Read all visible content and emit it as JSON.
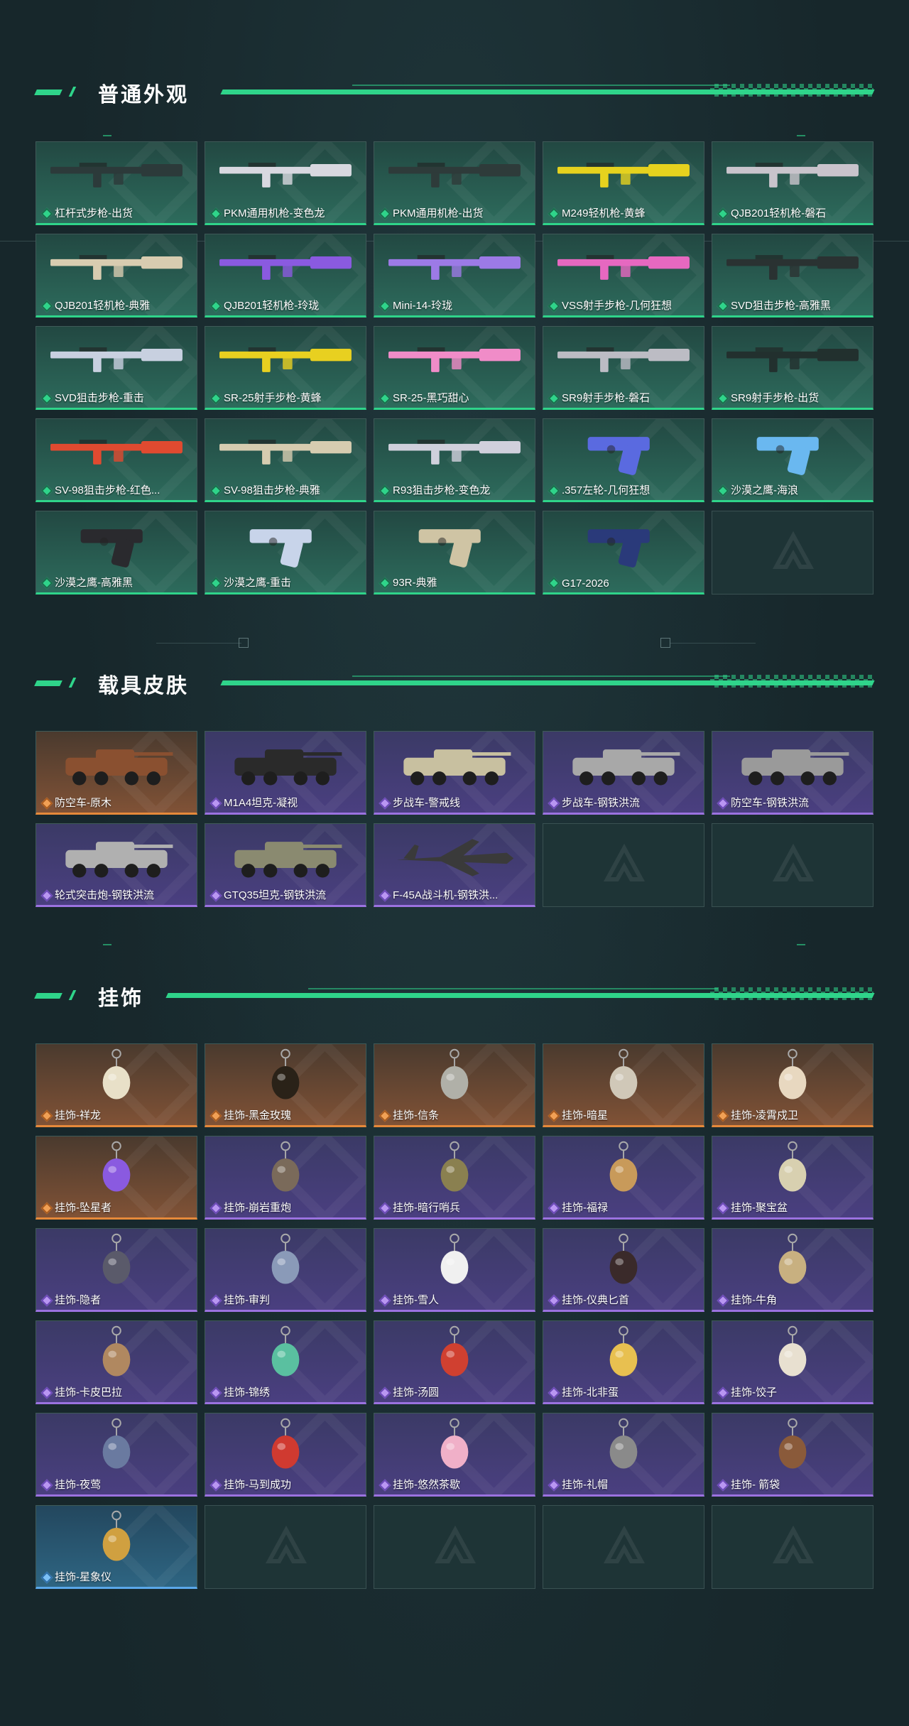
{
  "sections": {
    "weapons": {
      "title": "普通外观",
      "items": [
        {
          "label": "杠杆式步枪-出货",
          "rarity": "green",
          "icon": "rifle-icon",
          "color": "#2c3a3a"
        },
        {
          "label": "PKM通用机枪-变色龙",
          "rarity": "green",
          "icon": "machine-gun-icon",
          "color": "#d8d8e0"
        },
        {
          "label": "PKM通用机枪-出货",
          "rarity": "green",
          "icon": "machine-gun-icon",
          "color": "#2e3b3a"
        },
        {
          "label": "M249轻机枪-黄蜂",
          "rarity": "green",
          "icon": "machine-gun-icon",
          "color": "#e6d21e"
        },
        {
          "label": "QJB201轻机枪-磐石",
          "rarity": "green",
          "icon": "machine-gun-icon",
          "color": "#c9c4cc"
        },
        {
          "label": "QJB201轻机枪-典雅",
          "rarity": "green",
          "icon": "machine-gun-icon",
          "color": "#d8ccb0"
        },
        {
          "label": "QJB201轻机枪-玲珑",
          "rarity": "green",
          "icon": "machine-gun-icon",
          "color": "#8a5ae0"
        },
        {
          "label": "Mini-14-玲珑",
          "rarity": "green",
          "icon": "rifle-icon",
          "color": "#9c7ae6"
        },
        {
          "label": "VSS射手步枪-几何狂想",
          "rarity": "green",
          "icon": "rifle-icon",
          "color": "#e668c0"
        },
        {
          "label": "SVD狙击步枪-高雅黑",
          "rarity": "green",
          "icon": "sniper-rifle-icon",
          "color": "#2a3232"
        },
        {
          "label": "SVD狙击步枪-重击",
          "rarity": "green",
          "icon": "sniper-rifle-icon",
          "color": "#c8d0e0"
        },
        {
          "label": "SR-25射手步枪-黄蜂",
          "rarity": "green",
          "icon": "rifle-icon",
          "color": "#e8d020"
        },
        {
          "label": "SR-25-黑巧甜心",
          "rarity": "green",
          "icon": "rifle-icon",
          "color": "#f08cc8"
        },
        {
          "label": "SR9射手步枪-磐石",
          "rarity": "green",
          "icon": "rifle-icon",
          "color": "#bcbcc4"
        },
        {
          "label": "SR9射手步枪-出货",
          "rarity": "green",
          "icon": "rifle-icon",
          "color": "#22302e"
        },
        {
          "label": "SV-98狙击步枪-红色...",
          "rarity": "green",
          "icon": "sniper-rifle-icon",
          "color": "#e04a30"
        },
        {
          "label": "SV-98狙击步枪-典雅",
          "rarity": "green",
          "icon": "sniper-rifle-icon",
          "color": "#d6ccb0"
        },
        {
          "label": "R93狙击步枪-变色龙",
          "rarity": "green",
          "icon": "sniper-rifle-icon",
          "color": "#d0d0dc"
        },
        {
          "label": ".357左轮-几何狂想",
          "rarity": "green",
          "icon": "revolver-icon",
          "color": "#5a6ae0"
        },
        {
          "label": "沙漠之鹰-海浪",
          "rarity": "green",
          "icon": "pistol-icon",
          "color": "#6ab8f0"
        },
        {
          "label": "沙漠之鹰-高雅黑",
          "rarity": "green",
          "icon": "pistol-icon",
          "color": "#2a2a2e"
        },
        {
          "label": "沙漠之鹰-重击",
          "rarity": "green",
          "icon": "pistol-icon",
          "color": "#c8d4ea"
        },
        {
          "label": "93R-典雅",
          "rarity": "green",
          "icon": "pistol-icon",
          "color": "#cfc4a4"
        },
        {
          "label": "G17-2026",
          "rarity": "green",
          "icon": "pistol-icon",
          "color": "#2a3a7a"
        },
        {
          "label": "",
          "rarity": "empty",
          "icon": "empty-slot-icon",
          "color": ""
        }
      ]
    },
    "vehicles": {
      "title": "载具皮肤",
      "items": [
        {
          "label": "防空车-原木",
          "rarity": "orange",
          "icon": "armored-vehicle-icon",
          "color": "#8a5030"
        },
        {
          "label": "M1A4坦克-凝视",
          "rarity": "purple",
          "icon": "tank-icon",
          "color": "#2a2a2a"
        },
        {
          "label": "步战车-警戒线",
          "rarity": "purple",
          "icon": "armored-vehicle-icon",
          "color": "#c8c0a0"
        },
        {
          "label": "步战车-钢铁洪流",
          "rarity": "purple",
          "icon": "armored-vehicle-icon",
          "color": "#a8a8a8"
        },
        {
          "label": "防空车-钢铁洪流",
          "rarity": "purple",
          "icon": "armored-vehicle-icon",
          "color": "#9a9a9a"
        },
        {
          "label": "轮式突击炮-钢铁洪流",
          "rarity": "purple",
          "icon": "assault-gun-icon",
          "color": "#b0b0b0"
        },
        {
          "label": "GTQ35坦克-钢铁洪流",
          "rarity": "purple",
          "icon": "tank-icon",
          "color": "#8a8a70"
        },
        {
          "label": "F-45A战斗机-钢铁洪...",
          "rarity": "purple",
          "icon": "fighter-jet-icon",
          "color": "#3a3a3a"
        },
        {
          "label": "",
          "rarity": "empty",
          "icon": "empty-slot-icon",
          "color": ""
        },
        {
          "label": "",
          "rarity": "empty",
          "icon": "empty-slot-icon",
          "color": ""
        }
      ]
    },
    "charms": {
      "title": "挂饰",
      "items": [
        {
          "label": "挂饰-祥龙",
          "rarity": "orange",
          "icon": "dragon-charm-icon",
          "color": "#e8e0c8"
        },
        {
          "label": "挂饰-黑金玫瑰",
          "rarity": "orange",
          "icon": "rose-charm-icon",
          "color": "#2a2218"
        },
        {
          "label": "挂饰-信条",
          "rarity": "orange",
          "icon": "figure-charm-icon",
          "color": "#b0b0a8"
        },
        {
          "label": "挂饰-暗星",
          "rarity": "orange",
          "icon": "bird-charm-icon",
          "color": "#d0c8b8"
        },
        {
          "label": "挂饰-凌霄戍卫",
          "rarity": "orange",
          "icon": "bird-charm-icon",
          "color": "#e8d8c0"
        },
        {
          "label": "挂饰-坠星者",
          "rarity": "orange",
          "icon": "crystal-charm-icon",
          "color": "#8a5ae0"
        },
        {
          "label": "挂饰-崩岩重炮",
          "rarity": "purple",
          "icon": "figure-charm-icon",
          "color": "#7a6a5a"
        },
        {
          "label": "挂饰-暗行哨兵",
          "rarity": "purple",
          "icon": "figure-charm-icon",
          "color": "#8a8050"
        },
        {
          "label": "挂饰-福禄",
          "rarity": "purple",
          "icon": "gourd-charm-icon",
          "color": "#c89a5a"
        },
        {
          "label": "挂饰-聚宝盆",
          "rarity": "purple",
          "icon": "treasure-bowl-charm-icon",
          "color": "#d8d0b0"
        },
        {
          "label": "挂饰-隐者",
          "rarity": "purple",
          "icon": "card-charm-icon",
          "color": "#5a5a6a"
        },
        {
          "label": "挂饰-审判",
          "rarity": "purple",
          "icon": "card-charm-icon",
          "color": "#8a9ab8"
        },
        {
          "label": "挂饰-雪人",
          "rarity": "purple",
          "icon": "snowman-charm-icon",
          "color": "#f0f0f0"
        },
        {
          "label": "挂饰-仪典匕首",
          "rarity": "purple",
          "icon": "dagger-charm-icon",
          "color": "#3a2a2a"
        },
        {
          "label": "挂饰-牛角",
          "rarity": "purple",
          "icon": "horn-charm-icon",
          "color": "#c8b080"
        },
        {
          "label": "挂饰-卡皮巴拉",
          "rarity": "purple",
          "icon": "capybara-charm-icon",
          "color": "#b08860"
        },
        {
          "label": "挂饰-锦绣",
          "rarity": "purple",
          "icon": "butterfly-charm-icon",
          "color": "#5ac0a0"
        },
        {
          "label": "挂饰-汤圆",
          "rarity": "purple",
          "icon": "bowl-charm-icon",
          "color": "#d04030"
        },
        {
          "label": "挂饰-北非蛋",
          "rarity": "purple",
          "icon": "pan-charm-icon",
          "color": "#e8c050"
        },
        {
          "label": "挂饰-饺子",
          "rarity": "purple",
          "icon": "dumpling-charm-icon",
          "color": "#e8e0d0"
        },
        {
          "label": "挂饰-夜莺",
          "rarity": "purple",
          "icon": "feather-charm-icon",
          "color": "#6a7aa0"
        },
        {
          "label": "挂饰-马到成功",
          "rarity": "purple",
          "icon": "horse-charm-icon",
          "color": "#d03a30"
        },
        {
          "label": "挂饰-悠然茶歇",
          "rarity": "purple",
          "icon": "cupcake-charm-icon",
          "color": "#f0b0c8"
        },
        {
          "label": "挂饰-礼帽",
          "rarity": "purple",
          "icon": "hat-charm-icon",
          "color": "#8a8a8a"
        },
        {
          "label": "挂饰- 箭袋",
          "rarity": "purple",
          "icon": "quiver-charm-icon",
          "color": "#8a5a3a"
        },
        {
          "label": "挂饰-星象仪",
          "rarity": "blue",
          "icon": "astrolabe-charm-icon",
          "color": "#d0a040"
        },
        {
          "label": "",
          "rarity": "empty",
          "icon": "empty-slot-icon",
          "color": ""
        },
        {
          "label": "",
          "rarity": "empty",
          "icon": "empty-slot-icon",
          "color": ""
        },
        {
          "label": "",
          "rarity": "empty",
          "icon": "empty-slot-icon",
          "color": ""
        },
        {
          "label": "",
          "rarity": "empty",
          "icon": "empty-slot-icon",
          "color": ""
        }
      ]
    }
  },
  "colors": {
    "accent": "#2fd48a",
    "green_rarity": "#2fd48a",
    "purple_rarity": "#9b72e0",
    "orange_rarity": "#e6893a",
    "blue_rarity": "#5aa8ea"
  }
}
